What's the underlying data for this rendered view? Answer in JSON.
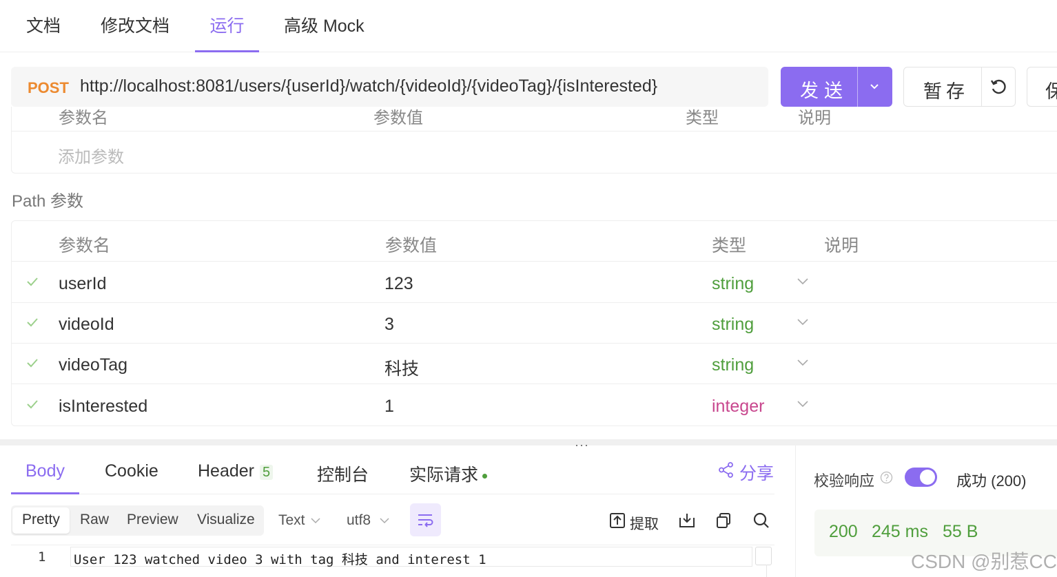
{
  "top_tabs": [
    {
      "label": "文档"
    },
    {
      "label": "修改文档"
    },
    {
      "label": "运行"
    },
    {
      "label": "高级 Mock"
    }
  ],
  "request": {
    "method": "POST",
    "url": "http://localhost:8081/users/{userId}/watch/{videoId}/{videoTag}/{isInterested}",
    "send_label": "发送",
    "save_label": "暂存",
    "more_label": "保"
  },
  "query_params": {
    "headers": [
      "参数名",
      "参数值",
      "类型",
      "说明"
    ],
    "add_placeholder": "添加参数"
  },
  "path_params": {
    "title": "Path 参数",
    "headers": [
      "参数名",
      "参数值",
      "类型",
      "说明"
    ],
    "rows": [
      {
        "name": "userId",
        "value": "123",
        "type": "string"
      },
      {
        "name": "videoId",
        "value": "3",
        "type": "string"
      },
      {
        "name": "videoTag",
        "value": "科技",
        "type": "string"
      },
      {
        "name": "isInterested",
        "value": "1",
        "type": "integer"
      }
    ]
  },
  "response": {
    "tabs": [
      {
        "label": "Body"
      },
      {
        "label": "Cookie"
      },
      {
        "label": "Header",
        "count": "5"
      },
      {
        "label": "控制台"
      },
      {
        "label": "实际请求"
      }
    ],
    "share_label": "分享",
    "views": [
      "Pretty",
      "Raw",
      "Preview",
      "Visualize"
    ],
    "format": "Text",
    "encoding": "utf8",
    "extract_label": "提取",
    "lines": [
      {
        "num": "1",
        "text": "User 123 watched video 3 with tag 科技 and interest 1"
      }
    ]
  },
  "validation": {
    "label": "校验响应",
    "result": "成功 (200)",
    "status": "200",
    "time": "245 ms",
    "size": "55 B"
  },
  "watermark": "CSDN @别惹CC",
  "colors": {
    "accent": "#8b6cf0",
    "method_post": "#ec8a30",
    "type_string": "#4f9e3c",
    "type_integer": "#c8478e"
  }
}
